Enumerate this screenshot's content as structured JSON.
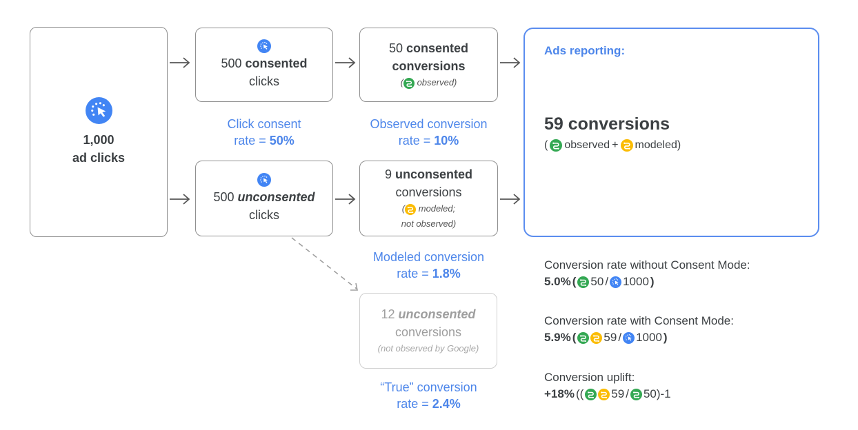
{
  "colors": {
    "accent_blue": "#4d86ea",
    "observed_green": "#34a853",
    "modeled_yellow": "#fbbc04",
    "click_blue": "#4285f4",
    "border_gray": "#8f8f8f"
  },
  "ad_clicks": {
    "icon": "click-cursor-icon",
    "count": "1,000",
    "label": "ad clicks"
  },
  "consented_clicks": {
    "icon": "click-cursor-icon",
    "count": "500",
    "bold": "consented",
    "label": "clicks"
  },
  "unconsented_clicks": {
    "icon": "click-cursor-icon",
    "count": "500",
    "bold": "unconsented",
    "label": "clicks"
  },
  "click_consent_rate": {
    "line1": "Click consent",
    "prefix": "rate = ",
    "value": "50%"
  },
  "consented_conversions": {
    "count": "50",
    "bold1": "consented",
    "bold2": "conversions",
    "open": "(",
    "icon": "observed-conversion-icon",
    "note": "observed)"
  },
  "observed_rate": {
    "line1": "Observed conversion",
    "prefix": "rate = ",
    "value": "10%"
  },
  "unconsented_conversions": {
    "count": "9",
    "bold": "unconsented",
    "label": "conversions",
    "open": "(",
    "icon": "modeled-conversion-icon",
    "note1": "modeled;",
    "note2": "not observed)"
  },
  "modeled_rate": {
    "line1": "Modeled conversion",
    "prefix": "rate = ",
    "value": "1.8%"
  },
  "true_conversions": {
    "count": "12",
    "bold": "unconsented",
    "label": "conversions",
    "note": "(not observed by Google)"
  },
  "true_rate": {
    "line1": "“True” conversion",
    "prefix": "rate = ",
    "value": "2.4%"
  },
  "ads_reporting": {
    "title": "Ads reporting:",
    "headline": "59 conversions",
    "open": "(",
    "observed": "observed",
    "plus": "+",
    "modeled": "modeled)"
  },
  "metrics": [
    {
      "label": "Conversion rate without Consent Mode:",
      "value": "5.0%",
      "open": "(",
      "n1": "50",
      "sep": "/",
      "n2": "1000",
      "close": ")"
    },
    {
      "label": "Conversion rate with Consent Mode:",
      "value": "5.9%",
      "open": "(",
      "n1": "59",
      "sep": "/",
      "n2": "1000",
      "close": ")"
    },
    {
      "label": "Conversion uplift:",
      "value": "+18%",
      "open": "((",
      "n1": "59",
      "sep": "/",
      "n2": "50)-1",
      "close": ")"
    }
  ]
}
